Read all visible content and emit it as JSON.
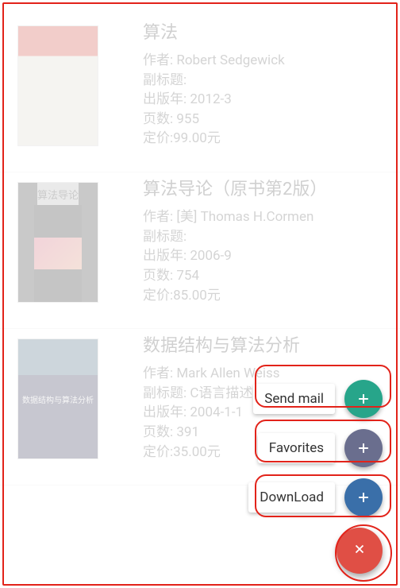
{
  "labels": {
    "author": "作者: ",
    "subtitle": "副标题: ",
    "year": "出版年: ",
    "pages": "页数: ",
    "price": "定价:"
  },
  "books": [
    {
      "title": "算法",
      "author": "Robert Sedgewick",
      "subtitle": "",
      "year": "2012-3",
      "pages": "955",
      "price": "99.00元"
    },
    {
      "title": "算法导论（原书第2版）",
      "author": "[美] Thomas H.Cormen",
      "subtitle": "",
      "year": "2006-9",
      "pages": "754",
      "price": "85.00元"
    },
    {
      "title": "数据结构与算法分析",
      "author": "Mark Allen Weiss",
      "subtitle": "C语言描述",
      "year": "2004-1-1",
      "pages": "391",
      "price": "35.00元"
    }
  ],
  "fab": {
    "sendmail": "Send mail",
    "favorites": "Favorites",
    "download": "DownLoad"
  }
}
